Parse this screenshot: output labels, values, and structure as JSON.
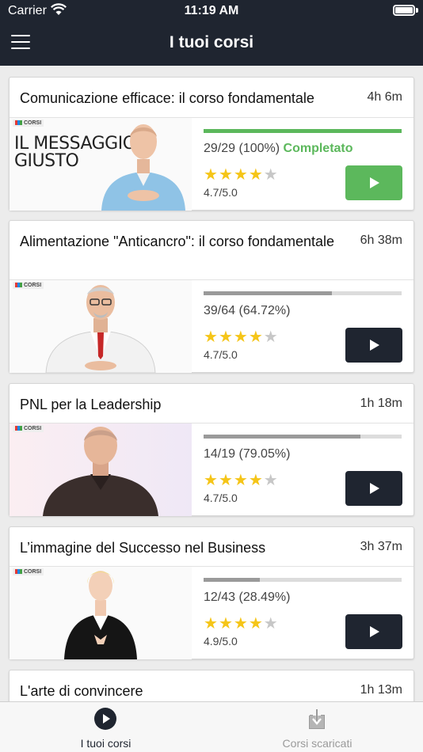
{
  "status_bar": {
    "carrier": "Carrier",
    "time": "11:19 AM"
  },
  "nav": {
    "title": "I tuoi corsi"
  },
  "courses": [
    {
      "title": "Comunicazione efficace: il corso fondamentale",
      "duration": "4h 6m",
      "progress": "29/29 (100%)",
      "status": "Completato",
      "progress_fraction": 1.0,
      "bar_color": "#5cb85c",
      "stars": 4,
      "rating": "4.7/5.0",
      "play_color": "#5cb85c",
      "thumbnail_text": "IL MESSAGGIO\nGIUSTO",
      "logo": "CORSI"
    },
    {
      "title": "Alimentazione \"Anticancro\": il corso fondamentale",
      "duration": "6h 38m",
      "progress": "39/64 (64.72%)",
      "progress_fraction": 0.6472,
      "bar_color": "#9a9a9a",
      "stars": 4,
      "rating": "4.7/5.0",
      "logo": "CORSI"
    },
    {
      "title": "PNL per la Leadership",
      "duration": "1h 18m",
      "progress": "14/19 (79.05%)",
      "progress_fraction": 0.7905,
      "bar_color": "#9a9a9a",
      "stars": 4,
      "rating": "4.7/5.0",
      "logo": "CORSI"
    },
    {
      "title": "L’immagine del Successo nel Business",
      "duration": "3h 37m",
      "progress": "12/43 (28.49%)",
      "progress_fraction": 0.2849,
      "bar_color": "#9a9a9a",
      "stars": 4,
      "rating": "4.9/5.0",
      "logo": "CORSI"
    },
    {
      "title": "L'arte di convincere",
      "duration": "1h 13m"
    }
  ],
  "tabs": [
    {
      "label": "I tuoi corsi",
      "icon": "play-circle-icon",
      "active": true
    },
    {
      "label": "Corsi scaricati",
      "icon": "download-icon",
      "active": false
    }
  ]
}
